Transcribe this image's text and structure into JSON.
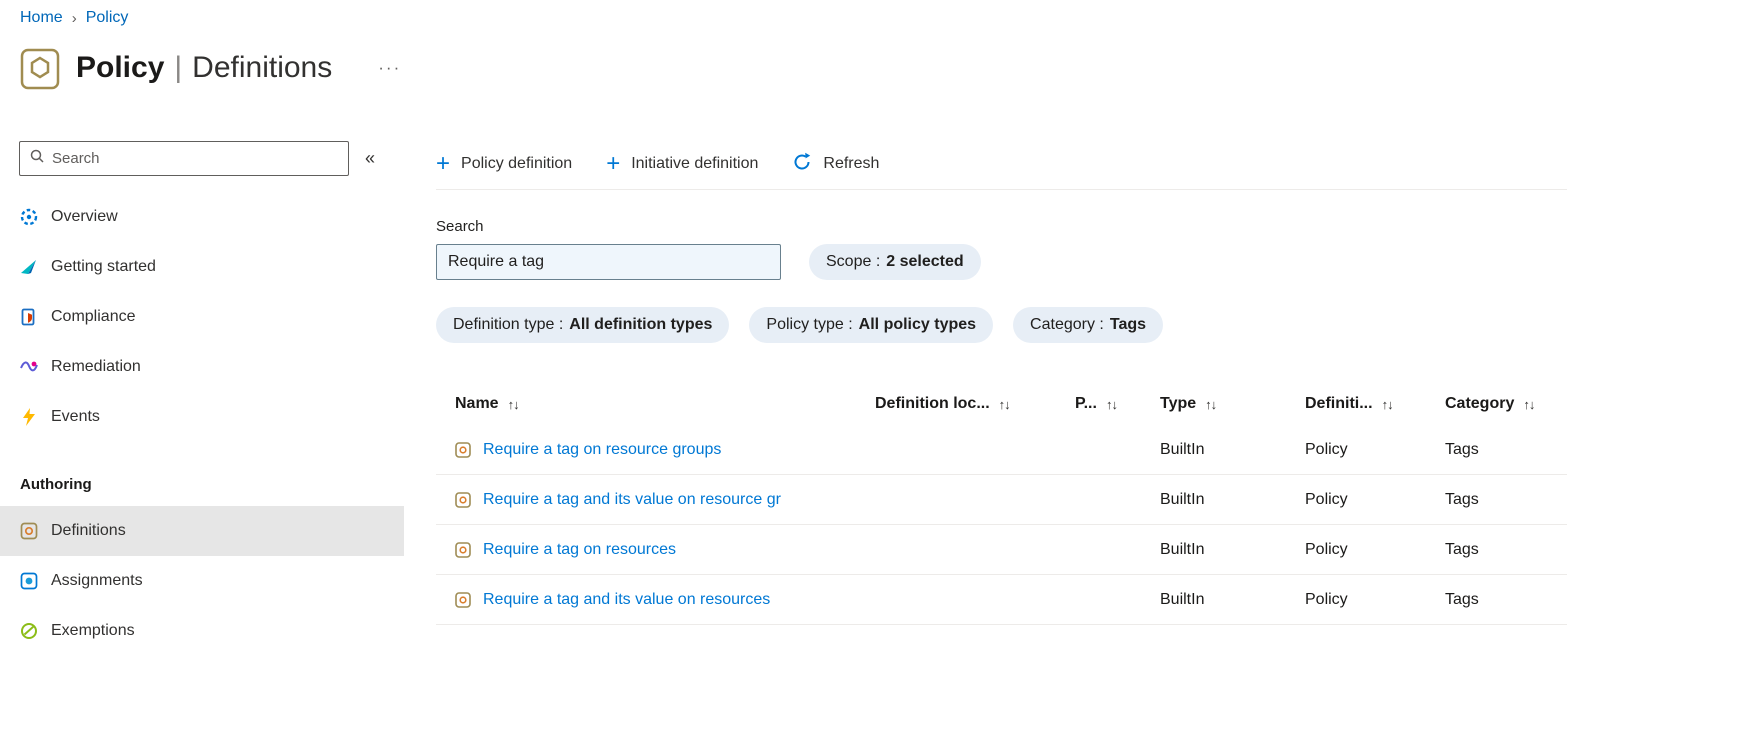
{
  "colors": {
    "accent": "#0078d4",
    "link": "#0067b8",
    "text": "#201f1e",
    "selected-bg": "#e6e6e6",
    "divider": "#edebe9",
    "input-bg": "#eff6fc",
    "pill-bg": "#e7eef6"
  },
  "icons": {
    "breadcrumb_chevron": "›",
    "more": "···",
    "collapse": "«",
    "plus": "+",
    "sort": "↑↓"
  },
  "breadcrumb": {
    "home": "Home",
    "policy": "Policy"
  },
  "header": {
    "title_primary": "Policy",
    "title_separator": "|",
    "title_secondary": "Definitions"
  },
  "sidebar": {
    "search_placeholder": "Search",
    "items": [
      {
        "label": "Overview"
      },
      {
        "label": "Getting started"
      },
      {
        "label": "Compliance"
      },
      {
        "label": "Remediation"
      },
      {
        "label": "Events"
      }
    ],
    "section_label": "Authoring",
    "authoring_items": [
      {
        "label": "Definitions",
        "selected": true
      },
      {
        "label": "Assignments",
        "selected": false
      },
      {
        "label": "Exemptions",
        "selected": false
      }
    ]
  },
  "toolbar": {
    "policy_definition": "Policy definition",
    "initiative_definition": "Initiative definition",
    "refresh": "Refresh"
  },
  "filters": {
    "search_label": "Search",
    "search_value": "Require a tag",
    "pills": [
      {
        "label": "Scope :",
        "value": "2 selected"
      },
      {
        "label": "Definition type :",
        "value": "All definition types"
      },
      {
        "label": "Policy type :",
        "value": "All policy types"
      },
      {
        "label": "Category :",
        "value": "Tags"
      }
    ]
  },
  "table": {
    "columns": [
      "Name",
      "Definition loc...",
      "P...",
      "Type",
      "Definiti...",
      "Category"
    ],
    "rows": [
      {
        "name": "Require a tag on resource groups",
        "type": "BuiltIn",
        "definition_type": "Policy",
        "category": "Tags"
      },
      {
        "name": "Require a tag and its value on resource gr",
        "type": "BuiltIn",
        "definition_type": "Policy",
        "category": "Tags"
      },
      {
        "name": "Require a tag on resources",
        "type": "BuiltIn",
        "definition_type": "Policy",
        "category": "Tags"
      },
      {
        "name": "Require a tag and its value on resources",
        "type": "BuiltIn",
        "definition_type": "Policy",
        "category": "Tags"
      }
    ]
  }
}
